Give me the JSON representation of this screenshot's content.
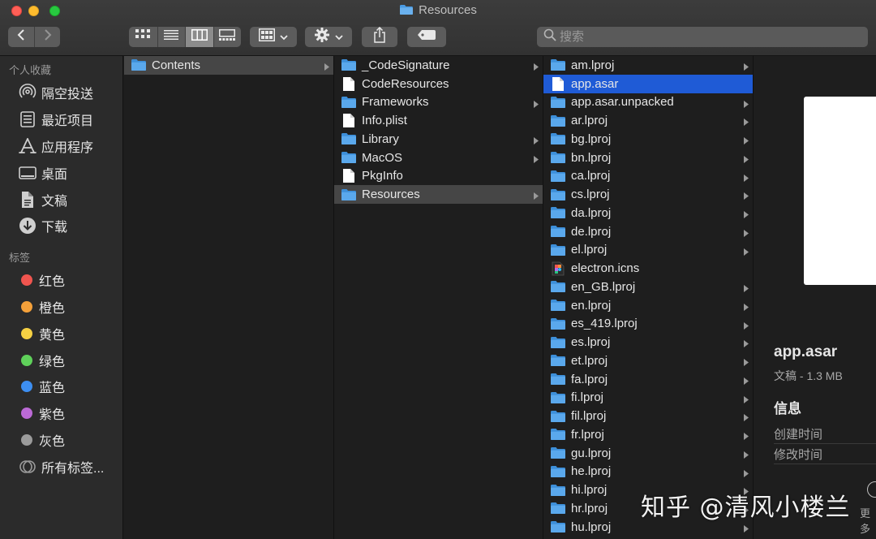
{
  "window": {
    "title": "Resources",
    "search_placeholder": "搜索"
  },
  "toolbar": {
    "back_icon": "chevron-left-icon",
    "forward_icon": "chevron-right-icon",
    "view_modes": [
      "icon-view",
      "list-view",
      "column-view",
      "gallery-view"
    ],
    "active_view": "column-view"
  },
  "sidebar": {
    "favorites_header": "个人收藏",
    "favorites": [
      {
        "label": "隔空投送",
        "icon": "airdrop-icon"
      },
      {
        "label": "最近项目",
        "icon": "recents-icon"
      },
      {
        "label": "应用程序",
        "icon": "applications-icon"
      },
      {
        "label": "桌面",
        "icon": "desktop-icon"
      },
      {
        "label": "文稿",
        "icon": "documents-icon"
      },
      {
        "label": "下载",
        "icon": "downloads-icon"
      }
    ],
    "tags_header": "标签",
    "tags": [
      {
        "label": "红色",
        "color": "#f0554f"
      },
      {
        "label": "橙色",
        "color": "#f5a13a"
      },
      {
        "label": "黄色",
        "color": "#f6d143"
      },
      {
        "label": "绿色",
        "color": "#5fd15a"
      },
      {
        "label": "蓝色",
        "color": "#3d8ff2"
      },
      {
        "label": "紫色",
        "color": "#bc6ad6"
      },
      {
        "label": "灰色",
        "color": "#9b9b9b"
      }
    ],
    "all_tags": "所有标签..."
  },
  "columns": [
    {
      "items": [
        {
          "name": "Contents",
          "type": "folder",
          "selected": "gray",
          "expand": true
        }
      ]
    },
    {
      "items": [
        {
          "name": "_CodeSignature",
          "type": "folder",
          "expand": true
        },
        {
          "name": "CodeResources",
          "type": "file",
          "expand": false
        },
        {
          "name": "Frameworks",
          "type": "folder",
          "expand": true
        },
        {
          "name": "Info.plist",
          "type": "file",
          "expand": false
        },
        {
          "name": "Library",
          "type": "folder",
          "expand": true
        },
        {
          "name": "MacOS",
          "type": "folder",
          "expand": true
        },
        {
          "name": "PkgInfo",
          "type": "file",
          "expand": false
        },
        {
          "name": "Resources",
          "type": "folder",
          "expand": true,
          "selected": "gray"
        }
      ]
    },
    {
      "items": [
        {
          "name": "am.lproj",
          "type": "folder",
          "expand": true
        },
        {
          "name": "app.asar",
          "type": "file",
          "expand": false,
          "selected": "blue"
        },
        {
          "name": "app.asar.unpacked",
          "type": "folder",
          "expand": true
        },
        {
          "name": "ar.lproj",
          "type": "folder",
          "expand": true
        },
        {
          "name": "bg.lproj",
          "type": "folder",
          "expand": true
        },
        {
          "name": "bn.lproj",
          "type": "folder",
          "expand": true
        },
        {
          "name": "ca.lproj",
          "type": "folder",
          "expand": true
        },
        {
          "name": "cs.lproj",
          "type": "folder",
          "expand": true
        },
        {
          "name": "da.lproj",
          "type": "folder",
          "expand": true
        },
        {
          "name": "de.lproj",
          "type": "folder",
          "expand": true
        },
        {
          "name": "el.lproj",
          "type": "folder",
          "expand": true
        },
        {
          "name": "electron.icns",
          "type": "icns",
          "expand": false
        },
        {
          "name": "en_GB.lproj",
          "type": "folder",
          "expand": true
        },
        {
          "name": "en.lproj",
          "type": "folder",
          "expand": true
        },
        {
          "name": "es_419.lproj",
          "type": "folder",
          "expand": true
        },
        {
          "name": "es.lproj",
          "type": "folder",
          "expand": true
        },
        {
          "name": "et.lproj",
          "type": "folder",
          "expand": true
        },
        {
          "name": "fa.lproj",
          "type": "folder",
          "expand": true
        },
        {
          "name": "fi.lproj",
          "type": "folder",
          "expand": true
        },
        {
          "name": "fil.lproj",
          "type": "folder",
          "expand": true
        },
        {
          "name": "fr.lproj",
          "type": "folder",
          "expand": true
        },
        {
          "name": "gu.lproj",
          "type": "folder",
          "expand": true
        },
        {
          "name": "he.lproj",
          "type": "folder",
          "expand": true
        },
        {
          "name": "hi.lproj",
          "type": "folder",
          "expand": true
        },
        {
          "name": "hr.lproj",
          "type": "folder",
          "expand": true
        },
        {
          "name": "hu.lproj",
          "type": "folder",
          "expand": true
        }
      ]
    }
  ],
  "preview": {
    "name": "app.asar",
    "kind": "文稿 - 1.3 MB",
    "info_header": "信息",
    "created_label": "创建时间",
    "modified_label": "修改时间",
    "more_label": "更多"
  },
  "watermark": "知乎 @清风小楼兰",
  "colors": {
    "folder": "#3d8fd9",
    "selection_blue": "#1f5bd6",
    "selection_gray": "#464646"
  }
}
